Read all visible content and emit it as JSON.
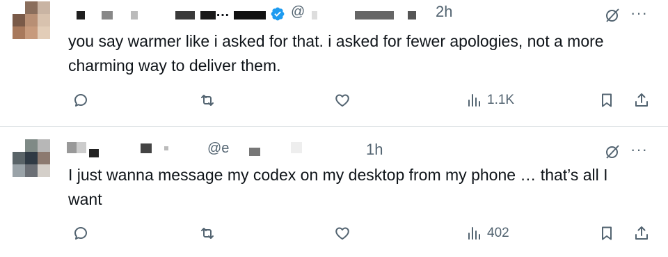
{
  "tweets": [
    {
      "author_name": "…",
      "handle": "@",
      "time": "2h",
      "text_line1": "you say warmer like i asked for that. i asked for fewer apologies, not a more",
      "text_line2": "charming way to deliver them.",
      "views": "1.1K",
      "verified": true
    },
    {
      "handle": "@e",
      "time": "1h",
      "text_line1": "I just wanna message my codex on my desktop from my phone … that’s all I",
      "text_line2": "want",
      "views": "402",
      "verified": false
    }
  ],
  "icons": {
    "reply": "reply-icon",
    "repost": "repost-icon",
    "like": "like-icon",
    "views": "views-icon",
    "bookmark": "bookmark-icon",
    "share": "share-icon",
    "grok": "grok-icon",
    "more": "more-icon"
  },
  "colors": {
    "text": "#0f1419",
    "secondary": "#536471",
    "verified": "#1d9bf0",
    "divider": "#dfe3e6"
  }
}
